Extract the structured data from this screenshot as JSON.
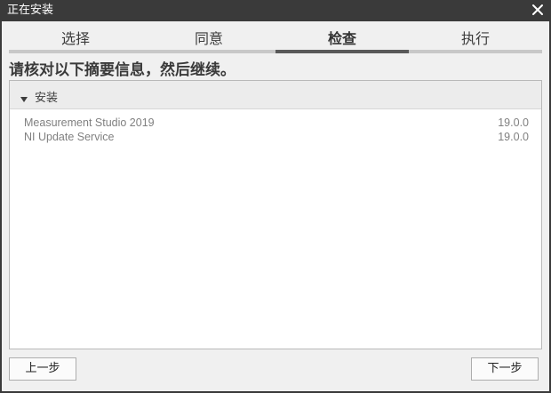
{
  "window": {
    "title": "正在安装"
  },
  "tabs": [
    {
      "label": "选择"
    },
    {
      "label": "同意"
    },
    {
      "label": "检查"
    },
    {
      "label": "执行"
    }
  ],
  "active_tab": "检查",
  "heading": "请核对以下摘要信息，然后继续。",
  "section": {
    "label": "安装",
    "expanded": true,
    "items": [
      {
        "name": "Measurement Studio 2019",
        "version": "19.0.0"
      },
      {
        "name": "NI Update Service",
        "version": "19.0.0"
      }
    ]
  },
  "buttons": {
    "back": "上一步",
    "next": "下一步"
  },
  "colors": {
    "titlebar": "#3a3a3a",
    "client": "#f0f0f0",
    "tab_indicator": "#595959",
    "tab_track": "#c8c8c8"
  }
}
